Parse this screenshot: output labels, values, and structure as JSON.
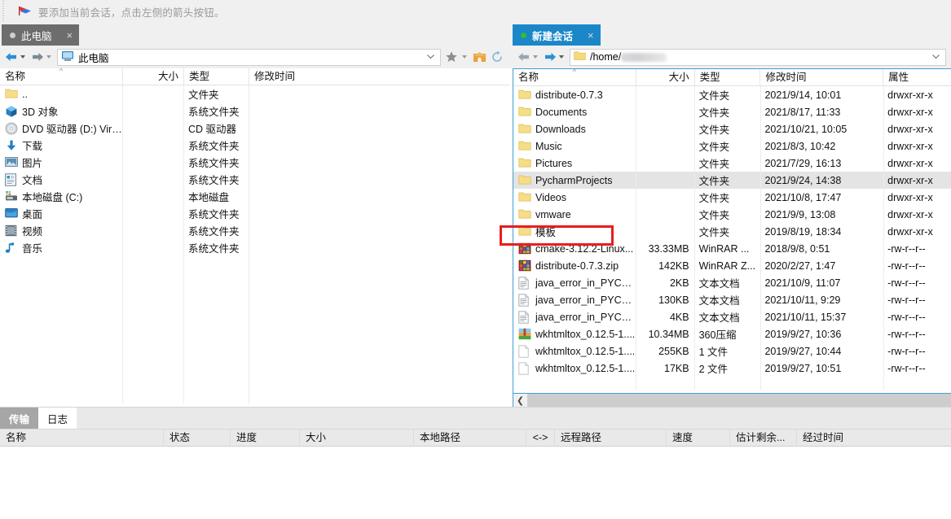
{
  "notice": {
    "icon": "flag-icon",
    "text": "要添加当前会话，点击左侧的箭头按钮。"
  },
  "colors": {
    "tab_active": "#1b87c9",
    "tab_inactive": "#6d6d6d",
    "annotation": "#e81d1d",
    "selection": "#e4e4e4",
    "panel_border": "#3e9fd4"
  },
  "left_pane": {
    "tab": {
      "label": "此电脑",
      "close": "×",
      "status_dot": "grey-dot-icon"
    },
    "toolbar": {
      "back": "back-arrow-icon",
      "back_menu": "chevron-down-icon",
      "forward": "forward-arrow-icon",
      "forward_menu": "chevron-down-icon",
      "path_icon": "computer-icon",
      "path_value": "此电脑",
      "path_dropdown": "chevron-down-icon",
      "bookmark": "star-icon",
      "bookmark_menu": "chevron-down-icon",
      "home": "home-icon",
      "refresh": "refresh-icon"
    },
    "columns": [
      "名称",
      "大小",
      "类型",
      "修改时间"
    ],
    "sort_column": "名称",
    "sort_direction": "ascending",
    "rows": [
      {
        "icon": "folder-icon",
        "name": "..",
        "size": "",
        "type": "文件夹",
        "modified": ""
      },
      {
        "icon": "3dobjects-icon",
        "name": "3D 对象",
        "size": "",
        "type": "系统文件夹",
        "modified": ""
      },
      {
        "icon": "disc-icon",
        "name": "DVD 驱动器 (D:) Virt...",
        "size": "",
        "type": "CD 驱动器",
        "modified": ""
      },
      {
        "icon": "download-icon",
        "name": "下载",
        "size": "",
        "type": "系统文件夹",
        "modified": ""
      },
      {
        "icon": "pictures-icon",
        "name": "图片",
        "size": "",
        "type": "系统文件夹",
        "modified": ""
      },
      {
        "icon": "documents-icon",
        "name": "文档",
        "size": "",
        "type": "系统文件夹",
        "modified": ""
      },
      {
        "icon": "harddisk-icon",
        "name": "本地磁盘 (C:)",
        "size": "",
        "type": "本地磁盘",
        "modified": ""
      },
      {
        "icon": "desktop-icon",
        "name": "桌面",
        "size": "",
        "type": "系统文件夹",
        "modified": ""
      },
      {
        "icon": "videos-icon",
        "name": "视频",
        "size": "",
        "type": "系统文件夹",
        "modified": ""
      },
      {
        "icon": "music-icon",
        "name": "音乐",
        "size": "",
        "type": "系统文件夹",
        "modified": ""
      }
    ]
  },
  "right_pane": {
    "tab": {
      "label": "新建会话",
      "close": "×",
      "status_dot": "green-dot-icon"
    },
    "toolbar": {
      "back": "back-arrow-icon",
      "back_menu": "chevron-down-icon",
      "forward": "forward-arrow-icon",
      "forward_menu": "chevron-down-icon",
      "path_icon": "folder-icon",
      "path_value": "/home/",
      "path_redacted": true,
      "path_dropdown": "chevron-down-icon"
    },
    "columns": [
      "名称",
      "大小",
      "类型",
      "修改时间",
      "属性"
    ],
    "sort_column": "名称",
    "sort_direction": "ascending",
    "selected_row": "PycharmProjects",
    "rows": [
      {
        "icon": "folder-icon",
        "name": "distribute-0.7.3",
        "size": "",
        "type": "文件夹",
        "modified": "2021/9/14, 10:01",
        "attrs": "drwxr-xr-x"
      },
      {
        "icon": "folder-icon",
        "name": "Documents",
        "size": "",
        "type": "文件夹",
        "modified": "2021/8/17, 11:33",
        "attrs": "drwxr-xr-x"
      },
      {
        "icon": "folder-icon",
        "name": "Downloads",
        "size": "",
        "type": "文件夹",
        "modified": "2021/10/21, 10:05",
        "attrs": "drwxr-xr-x"
      },
      {
        "icon": "folder-icon",
        "name": "Music",
        "size": "",
        "type": "文件夹",
        "modified": "2021/8/3, 10:42",
        "attrs": "drwxr-xr-x"
      },
      {
        "icon": "folder-icon",
        "name": "Pictures",
        "size": "",
        "type": "文件夹",
        "modified": "2021/7/29, 16:13",
        "attrs": "drwxr-xr-x"
      },
      {
        "icon": "folder-icon",
        "name": "PycharmProjects",
        "size": "",
        "type": "文件夹",
        "modified": "2021/9/24, 14:38",
        "attrs": "drwxr-xr-x"
      },
      {
        "icon": "folder-icon",
        "name": "Videos",
        "size": "",
        "type": "文件夹",
        "modified": "2021/10/8, 17:47",
        "attrs": "drwxr-xr-x"
      },
      {
        "icon": "folder-icon",
        "name": "vmware",
        "size": "",
        "type": "文件夹",
        "modified": "2021/9/9, 13:08",
        "attrs": "drwxr-xr-x"
      },
      {
        "icon": "folder-icon",
        "name": "模板",
        "size": "",
        "type": "文件夹",
        "modified": "2019/8/19, 18:34",
        "attrs": "drwxr-xr-x"
      },
      {
        "icon": "winrar-icon",
        "name": "cmake-3.12.2-Linux...",
        "size": "33.33MB",
        "type": "WinRAR ...",
        "modified": "2018/9/8, 0:51",
        "attrs": "-rw-r--r--"
      },
      {
        "icon": "winrar-icon",
        "name": "distribute-0.7.3.zip",
        "size": "142KB",
        "type": "WinRAR Z...",
        "modified": "2020/2/27, 1:47",
        "attrs": "-rw-r--r--"
      },
      {
        "icon": "text-icon",
        "name": "java_error_in_PYCH...",
        "size": "2KB",
        "type": "文本文档",
        "modified": "2021/10/9, 11:07",
        "attrs": "-rw-r--r--"
      },
      {
        "icon": "text-icon",
        "name": "java_error_in_PYCH...",
        "size": "130KB",
        "type": "文本文档",
        "modified": "2021/10/11, 9:29",
        "attrs": "-rw-r--r--"
      },
      {
        "icon": "text-icon",
        "name": "java_error_in_PYCH...",
        "size": "4KB",
        "type": "文本文档",
        "modified": "2021/10/11, 15:37",
        "attrs": "-rw-r--r--"
      },
      {
        "icon": "archive360-icon",
        "name": "wkhtmltox_0.12.5-1....",
        "size": "10.34MB",
        "type": "360压缩",
        "modified": "2019/9/27, 10:36",
        "attrs": "-rw-r--r--"
      },
      {
        "icon": "blank-icon",
        "name": "wkhtmltox_0.12.5-1....",
        "size": "255KB",
        "type": "1 文件",
        "modified": "2019/9/27, 10:44",
        "attrs": "-rw-r--r--"
      },
      {
        "icon": "blank-icon",
        "name": "wkhtmltox_0.12.5-1....",
        "size": "17KB",
        "type": "2 文件",
        "modified": "2019/9/27, 10:51",
        "attrs": "-rw-r--r--"
      }
    ],
    "scrollbar": {
      "left_arrow": "chevron-left-icon"
    }
  },
  "bottom_panel": {
    "tabs": [
      {
        "label": "传输",
        "active": true
      },
      {
        "label": "日志",
        "active": false
      }
    ],
    "columns": [
      "名称",
      "状态",
      "进度",
      "大小",
      "本地路径",
      "<->",
      "远程路径",
      "速度",
      "估计剩余...",
      "经过时间"
    ],
    "rows": []
  },
  "annotation": {
    "shape": "rectangle",
    "target": "模板"
  }
}
